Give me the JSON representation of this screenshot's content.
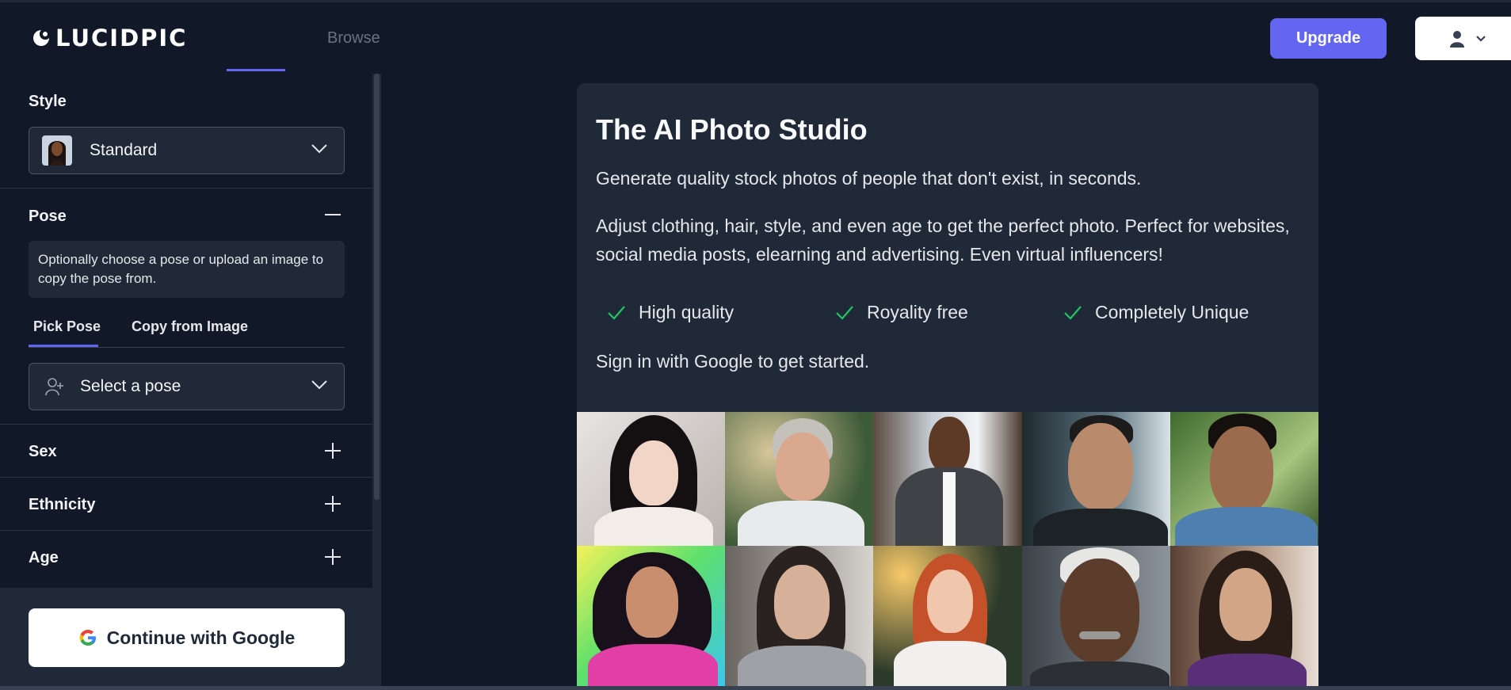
{
  "header": {
    "logo_text": "LUCIDPIC",
    "nav_browse": "Browse",
    "upgrade_label": "Upgrade",
    "user_icon": "user-icon",
    "accent_color": "#6366f1"
  },
  "sidebar": {
    "style": {
      "title": "Style",
      "selected": "Standard"
    },
    "pose": {
      "title": "Pose",
      "info": "Optionally choose a pose or upload an image to copy the pose from.",
      "tabs": [
        "Pick Pose",
        "Copy from Image"
      ],
      "active_tab": "Pick Pose",
      "select_placeholder": "Select a pose"
    },
    "sections": [
      {
        "title": "Sex"
      },
      {
        "title": "Ethnicity"
      },
      {
        "title": "Age"
      }
    ],
    "google_button": "Continue with Google"
  },
  "main": {
    "title": "The AI Photo Studio",
    "intro": "Generate quality stock photos of people that don't exist, in seconds.",
    "description": "Adjust clothing, hair, style, and even age to get the perfect photo. Perfect for websites, social media posts, elearning and advertising. Even virtual influencers!",
    "features": [
      "High quality",
      "Royality free",
      "Completely Unique"
    ],
    "cta": "Sign in with Google to get started.",
    "check_color": "#22c55e"
  }
}
